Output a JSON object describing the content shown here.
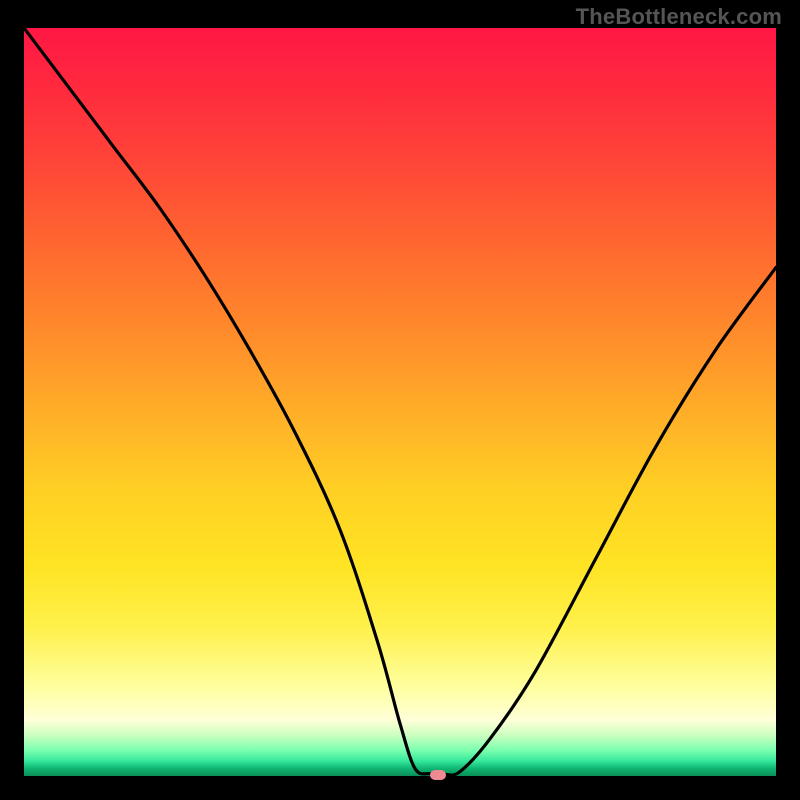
{
  "watermark": "TheBottleneck.com",
  "colors": {
    "page_bg": "#000000",
    "curve_stroke": "#000000",
    "marker_fill": "#ef8a92",
    "watermark_text": "#555555"
  },
  "chart_data": {
    "type": "line",
    "title": "",
    "xlabel": "",
    "ylabel": "",
    "xlim": [
      0,
      100
    ],
    "ylim": [
      0,
      100
    ],
    "grid": false,
    "legend": false,
    "series": [
      {
        "name": "bottleneck-curve",
        "x": [
          0,
          6,
          12,
          18,
          24,
          30,
          36,
          42,
          47,
          50,
          52,
          54,
          56,
          58,
          62,
          68,
          76,
          84,
          92,
          100
        ],
        "values": [
          100,
          92,
          84,
          76,
          67,
          57,
          46,
          33,
          18,
          7,
          1,
          0.3,
          0.2,
          0.6,
          5,
          14,
          29,
          44,
          57,
          68
        ]
      }
    ],
    "background_gradient": {
      "direction": "top-to-bottom",
      "stops": [
        {
          "pos": 0.0,
          "color": "#ff1745"
        },
        {
          "pos": 0.3,
          "color": "#ff6a2f"
        },
        {
          "pos": 0.62,
          "color": "#ffd024"
        },
        {
          "pos": 0.88,
          "color": "#ffff9e"
        },
        {
          "pos": 0.965,
          "color": "#7dffb0"
        },
        {
          "pos": 1.0,
          "color": "#0a8f57"
        }
      ]
    },
    "marker": {
      "x": 55,
      "y": 0.2,
      "shape": "pill",
      "color": "#ef8a92"
    }
  }
}
